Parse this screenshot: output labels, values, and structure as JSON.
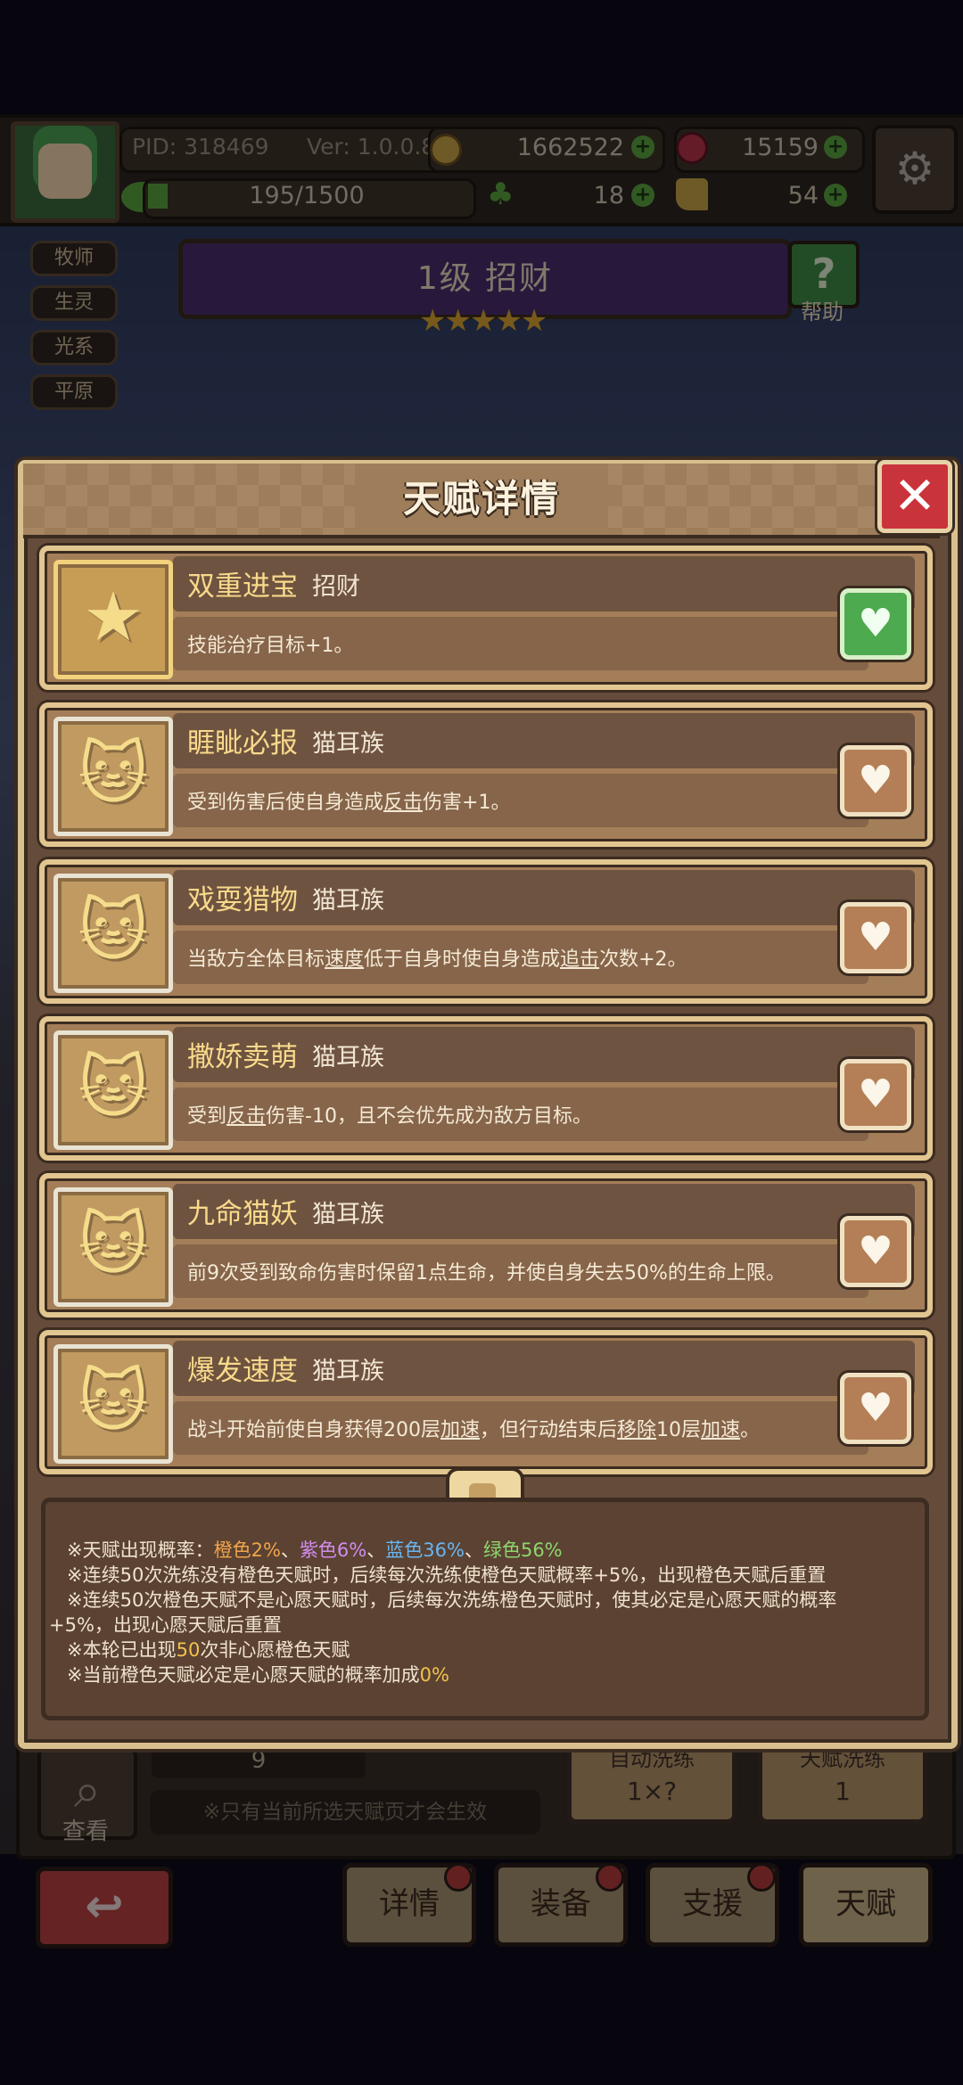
{
  "topbar": {
    "pid": "PID: 318469",
    "version": "Ver: 1.0.0.8",
    "gold": "1662522",
    "gems": "15159",
    "exp": "195/1500",
    "clover": "18",
    "boot": "54"
  },
  "class_tags": [
    "牧师",
    "生灵",
    "光系",
    "平原"
  ],
  "hero": {
    "title": "1级 招财",
    "help_label": "帮助",
    "help_glyph": "?",
    "stars": "★★★★★"
  },
  "bottom": {
    "search_label": "查看",
    "potion_count": "9",
    "note": "※只有当前所选天赋页才会生效",
    "auto_refine": {
      "label": "自动洗练",
      "value": "1×?"
    },
    "talent_refine": {
      "label": "天赋洗练",
      "value": "1"
    }
  },
  "nav": {
    "back_glyph": "↩",
    "details": "详情",
    "equipment": "装备",
    "support": "支援",
    "talent": "天赋"
  },
  "popup": {
    "title": "天赋详情",
    "close_glyph": "✕",
    "talents": [
      {
        "name": "双重进宝",
        "tribe": "招财",
        "icon": "star-icon",
        "glyph": "★",
        "heart_on": true,
        "desc_parts": [
          {
            "t": "技能治疗目标+1。",
            "u": false
          }
        ]
      },
      {
        "name": "睚眦必报",
        "tribe": "猫耳族",
        "icon": "cat-icon",
        "glyph": "🐱",
        "heart_on": false,
        "desc_parts": [
          {
            "t": "受到伤害后使自身造成",
            "u": false
          },
          {
            "t": "反击",
            "u": true
          },
          {
            "t": "伤害+1。",
            "u": false
          }
        ]
      },
      {
        "name": "戏耍猎物",
        "tribe": "猫耳族",
        "icon": "cat-icon",
        "glyph": "🐱",
        "heart_on": false,
        "desc_parts": [
          {
            "t": "当敌方全体目标",
            "u": false
          },
          {
            "t": "速度",
            "u": true
          },
          {
            "t": "低于自身时使自身造成",
            "u": false
          },
          {
            "t": "追击",
            "u": true
          },
          {
            "t": "次数+2。",
            "u": false
          }
        ]
      },
      {
        "name": "撒娇卖萌",
        "tribe": "猫耳族",
        "icon": "cat-icon",
        "glyph": "🐱",
        "heart_on": false,
        "desc_parts": [
          {
            "t": "受到",
            "u": false
          },
          {
            "t": "反击",
            "u": true
          },
          {
            "t": "伤害-10，且不会优先成为敌方目标。",
            "u": false
          }
        ]
      },
      {
        "name": "九命猫妖",
        "tribe": "猫耳族",
        "icon": "cat-icon",
        "glyph": "🐱",
        "heart_on": false,
        "desc_parts": [
          {
            "t": "前9次受到致命伤害时保留1点生命，并使自身失去50%的生命上限。",
            "u": false
          }
        ]
      },
      {
        "name": "爆发速度",
        "tribe": "猫耳族",
        "icon": "cat-icon",
        "glyph": "🐱",
        "heart_on": false,
        "desc_parts": [
          {
            "t": "战斗开始前使自身获得200层",
            "u": false
          },
          {
            "t": "加速",
            "u": true
          },
          {
            "t": "，但行动结束后",
            "u": false
          },
          {
            "t": "移除",
            "u": true
          },
          {
            "t": "10层",
            "u": false
          },
          {
            "t": "加速",
            "u": true
          },
          {
            "t": "。",
            "u": false
          }
        ]
      }
    ],
    "info": {
      "rate_prefix": "※天赋出现概率：",
      "rate_orange": "橙色2%",
      "rate_sep1": "、",
      "rate_purple": "紫色6%",
      "rate_sep2": "、",
      "rate_blue": "蓝色36%",
      "rate_sep3": "、",
      "rate_green": "绿色56%",
      "line2": "※连续50次洗练没有橙色天赋时，后续每次洗练使橙色天赋概率+5%，出现橙色天赋后重置",
      "line3": "※连续50次橙色天赋不是心愿天赋时，后续每次洗练橙色天赋时，使其必定是心愿天赋的概率",
      "line4": "+5%，出现心愿天赋后重置",
      "line5_prefix": "※本轮已出现",
      "line5_count": "50",
      "line5_suffix": "次非心愿橙色天赋",
      "line6_prefix": "※当前橙色天赋必定是心愿天赋的概率加成",
      "line6_value": "0%"
    }
  },
  "colors": {
    "accent_orange": "#f2a44a",
    "accent_purple": "#d18cf0",
    "accent_blue": "#67b6f2",
    "accent_green": "#8fd66d",
    "close_red": "#c9333b",
    "heart_green": "#4daa4e"
  }
}
